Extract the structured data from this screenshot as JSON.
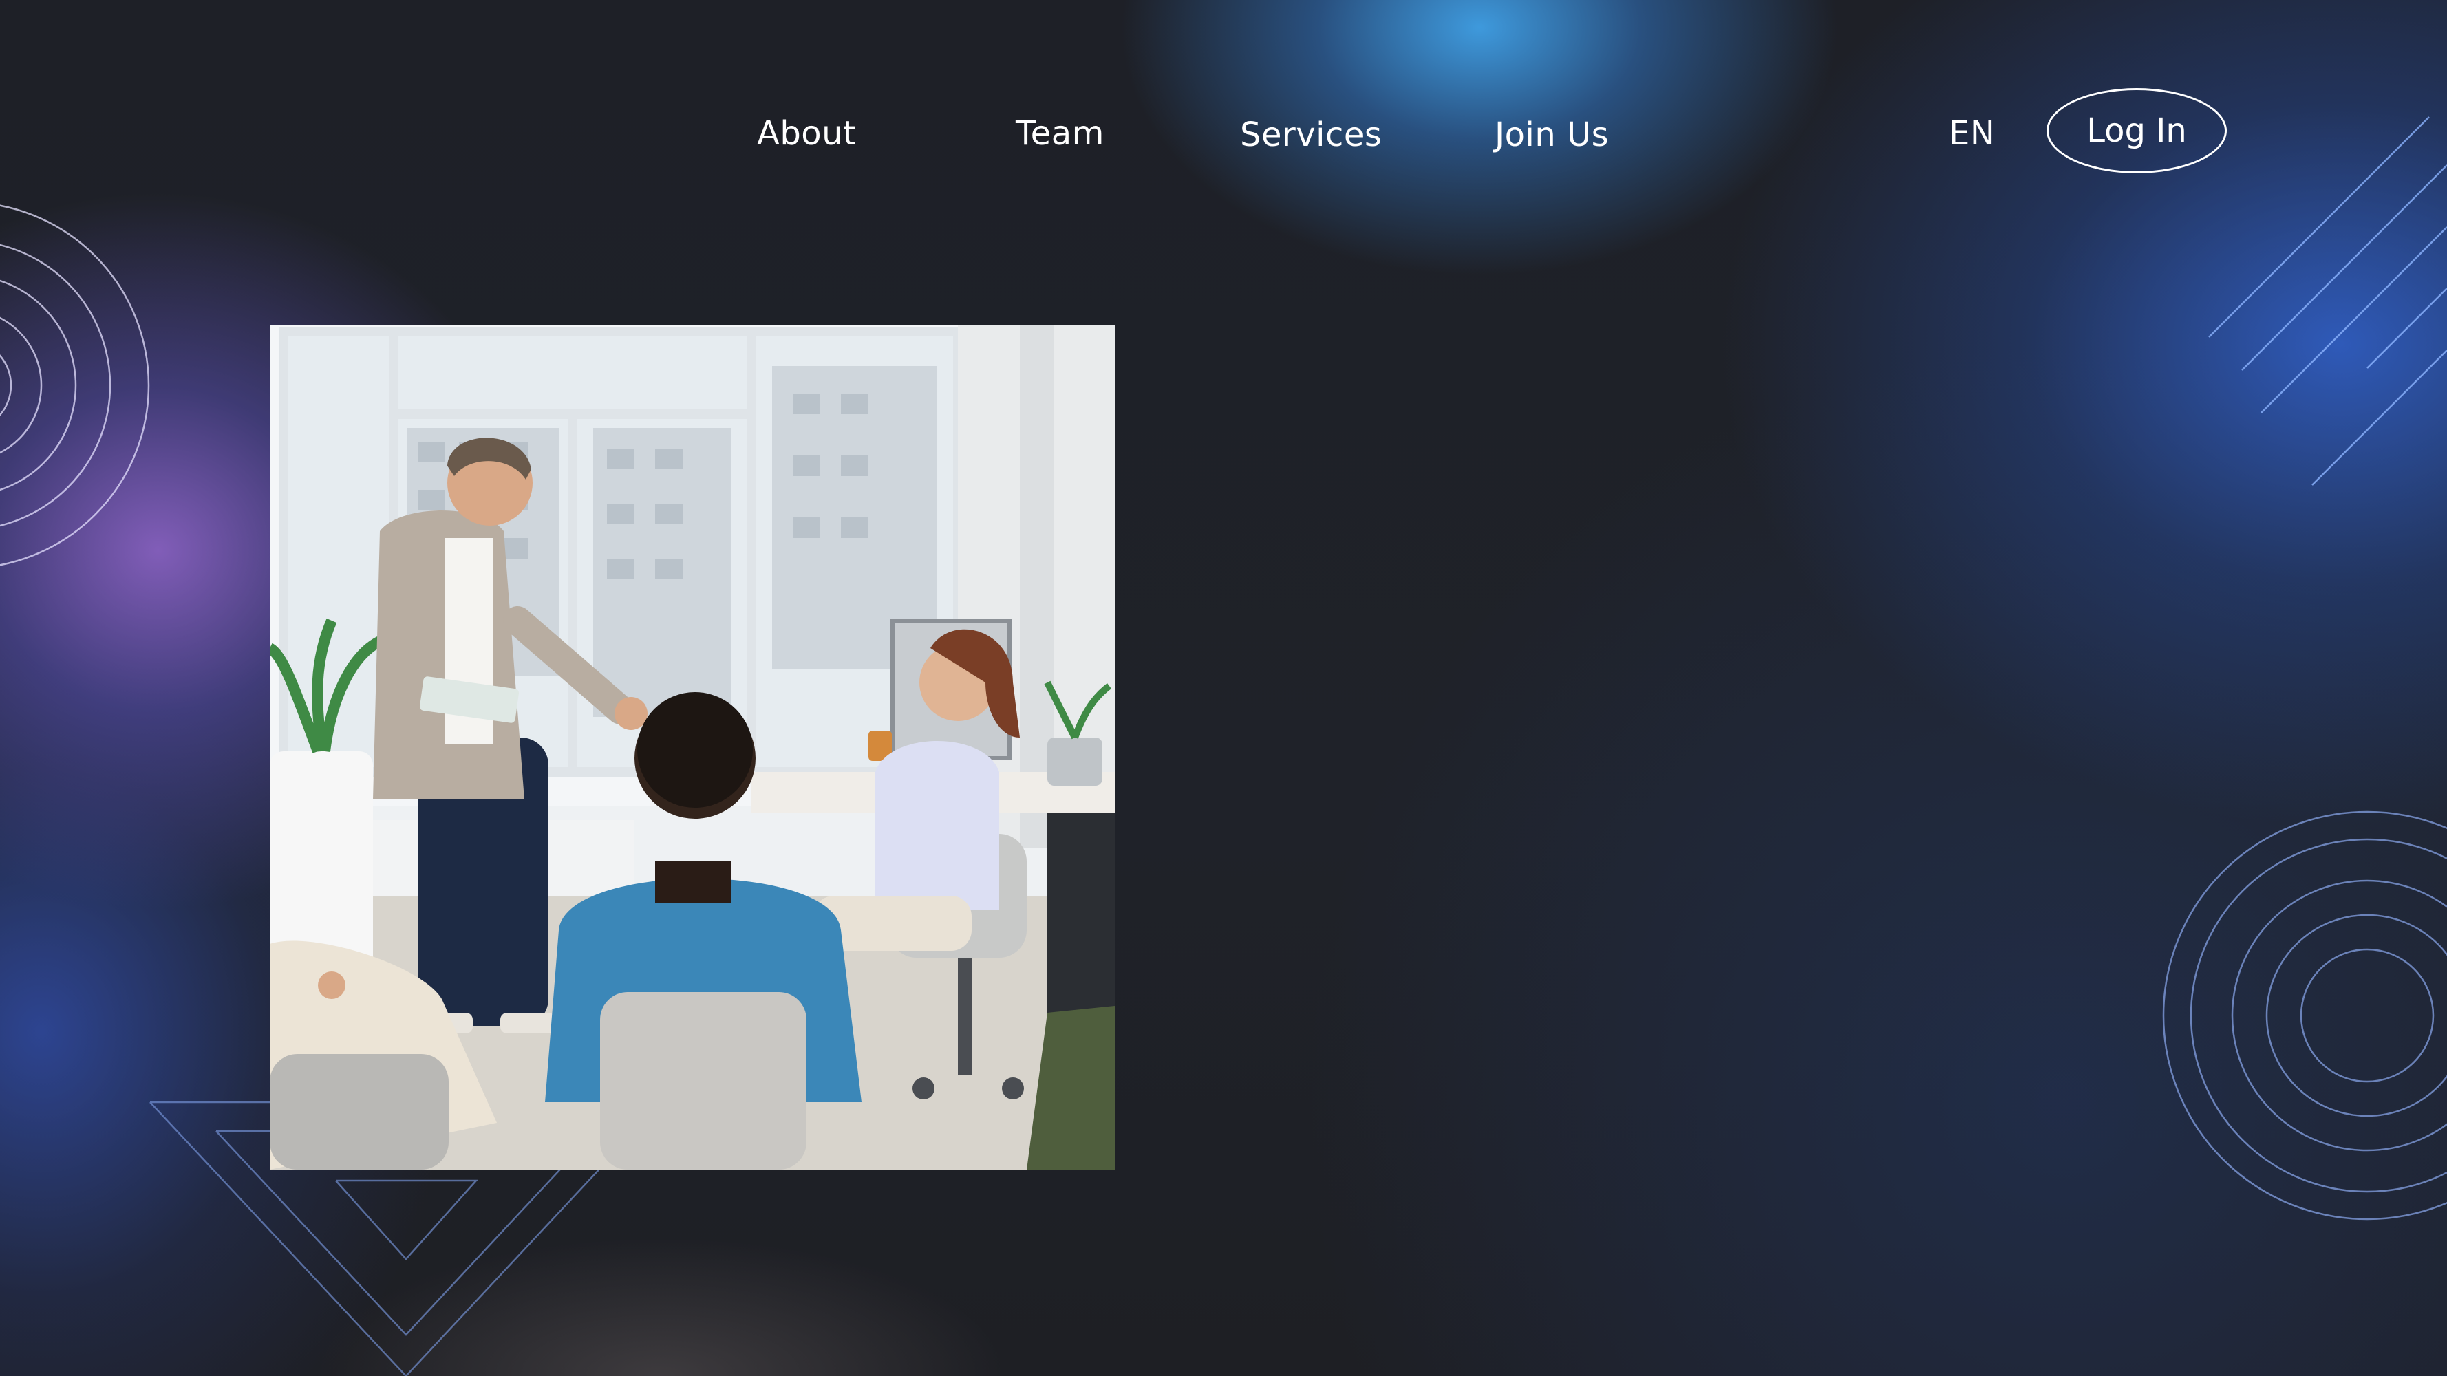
{
  "nav": {
    "items": [
      {
        "label": "About"
      },
      {
        "label": "Team"
      },
      {
        "label": "Services"
      },
      {
        "label": "Join Us"
      }
    ]
  },
  "header": {
    "language": "EN",
    "login_label": "Log In"
  },
  "hero": {
    "image": "office-meeting-photo"
  },
  "colors": {
    "background": "#1f2127",
    "accent_blue": "#3f9fe0",
    "accent_purple": "#8c64c8",
    "text": "#ffffff"
  }
}
